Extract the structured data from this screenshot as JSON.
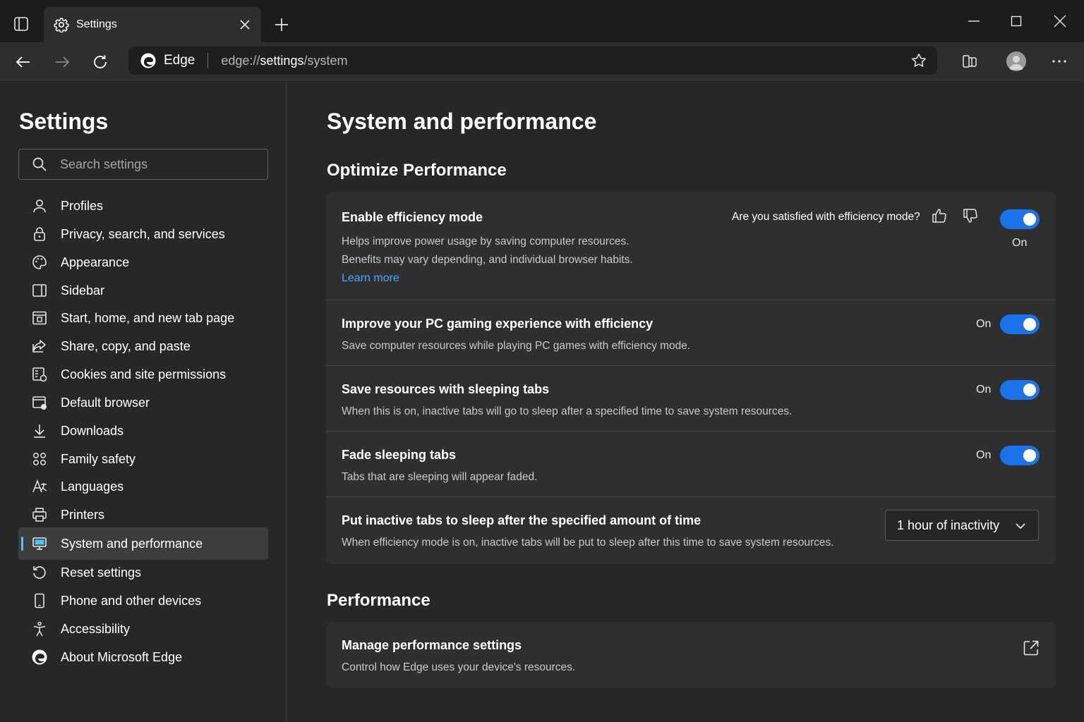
{
  "window": {
    "tab_title": "Settings",
    "icons": {
      "tab_actions": "tab-actions-icon",
      "tab_settings": "gear-icon",
      "close_tab": "close-icon",
      "new_tab": "plus-icon",
      "minimize": "minimize-icon",
      "maximize": "maximize-icon",
      "close_window": "close-icon"
    }
  },
  "toolbar": {
    "site_label": "Edge",
    "url_scheme": "edge://",
    "url_host": "settings",
    "url_path": "/system",
    "icons": {
      "back": "arrow-left-icon",
      "forward": "arrow-right-icon",
      "refresh": "refresh-icon",
      "favorite": "star-icon",
      "split": "split-screen-icon",
      "profile": "avatar-icon",
      "menu": "more-icon"
    }
  },
  "sidebar": {
    "title": "Settings",
    "search_placeholder": "Search settings",
    "items": [
      {
        "label": "Profiles",
        "icon": "profile-icon"
      },
      {
        "label": "Privacy, search, and services",
        "icon": "lock-icon"
      },
      {
        "label": "Appearance",
        "icon": "palette-icon"
      },
      {
        "label": "Sidebar",
        "icon": "sidebar-icon"
      },
      {
        "label": "Start, home, and new tab page",
        "icon": "home-tab-icon"
      },
      {
        "label": "Share, copy, and paste",
        "icon": "share-icon"
      },
      {
        "label": "Cookies and site permissions",
        "icon": "cookies-icon"
      },
      {
        "label": "Default browser",
        "icon": "browser-icon"
      },
      {
        "label": "Downloads",
        "icon": "download-icon"
      },
      {
        "label": "Family safety",
        "icon": "family-icon"
      },
      {
        "label": "Languages",
        "icon": "languages-icon"
      },
      {
        "label": "Printers",
        "icon": "printer-icon"
      },
      {
        "label": "System and performance",
        "icon": "computer-icon",
        "active": true
      },
      {
        "label": "Reset settings",
        "icon": "reset-icon"
      },
      {
        "label": "Phone and other devices",
        "icon": "phone-icon"
      },
      {
        "label": "Accessibility",
        "icon": "accessibility-icon"
      },
      {
        "label": "About Microsoft Edge",
        "icon": "edge-logo-icon"
      }
    ]
  },
  "main": {
    "title": "System and performance",
    "optimize": {
      "heading": "Optimize Performance",
      "efficiency": {
        "title": "Enable efficiency mode",
        "desc_line1": "Helps improve power usage by saving computer resources.",
        "desc_line2": "Benefits may vary depending, and individual browser habits.",
        "learn_more": "Learn more",
        "feedback_question": "Are you satisfied with efficiency mode?",
        "state": "On"
      },
      "gaming": {
        "title": "Improve your PC gaming experience with efficiency",
        "desc": "Save computer resources while playing PC games with efficiency mode.",
        "state": "On"
      },
      "sleeping_tabs": {
        "title": "Save resources with sleeping tabs",
        "desc": "When this is on, inactive tabs will go to sleep after a specified time to save system resources.",
        "state": "On"
      },
      "fade_tabs": {
        "title": "Fade sleeping tabs",
        "desc": "Tabs that are sleeping will appear faded.",
        "state": "On"
      },
      "sleep_timer": {
        "title": "Put inactive tabs to sleep after the specified amount of time",
        "desc": "When efficiency mode is on, inactive tabs will be put to sleep after this time to save system resources.",
        "selected": "1 hour of inactivity"
      }
    },
    "performance": {
      "heading": "Performance",
      "manage": {
        "title": "Manage performance settings",
        "desc": "Control how Edge uses your device's resources."
      }
    }
  },
  "colors": {
    "accent": "#1a73e8",
    "link": "#4aa8ff",
    "active_indicator": "#4cc2ff"
  }
}
